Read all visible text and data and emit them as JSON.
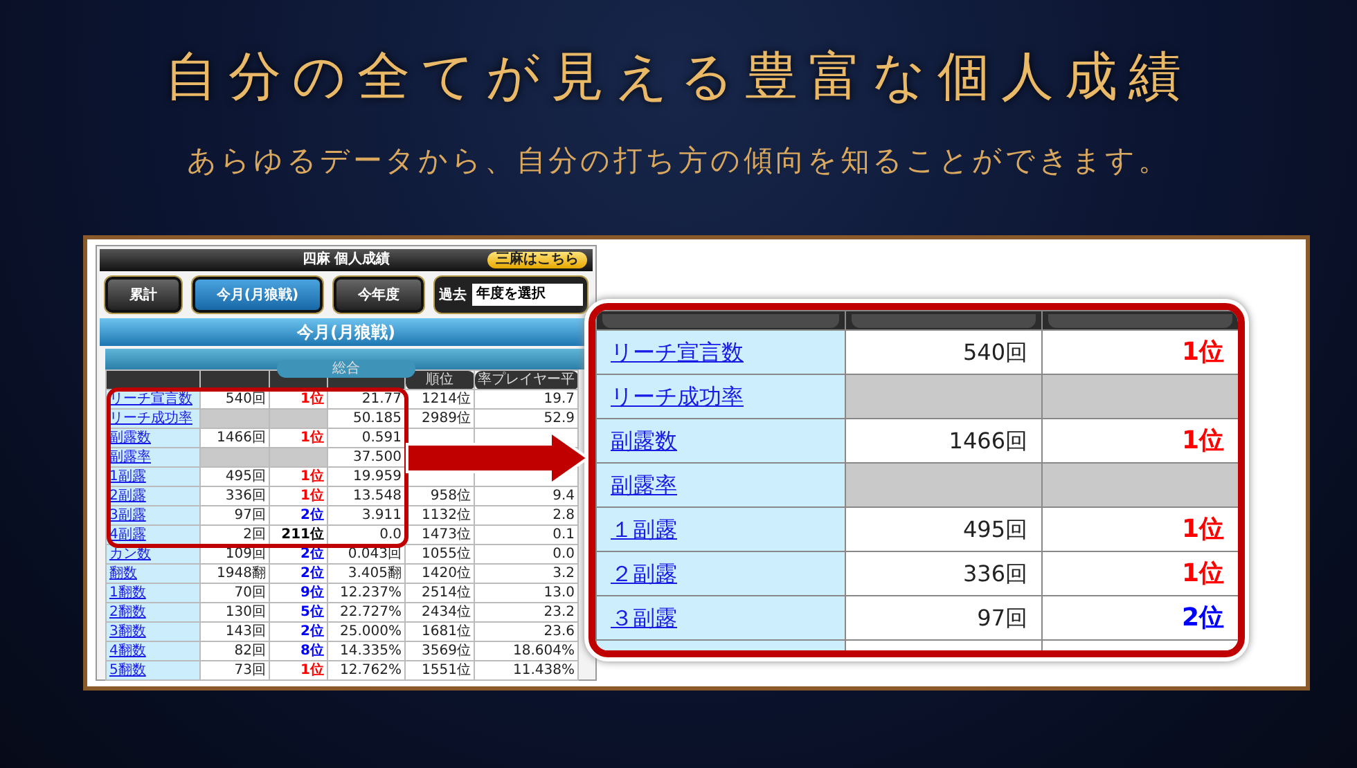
{
  "headline": "自分の全てが見える豊富な個人成績",
  "subheadline": "あらゆるデータから、自分の打ち方の傾向を知ることができます。",
  "app": {
    "title": "四麻 個人成績",
    "switch_button": "三麻はこちら",
    "period_tabs": [
      {
        "label": "累計",
        "selected": false
      },
      {
        "label": "今月(月狼戦)",
        "selected": true
      },
      {
        "label": "今年度",
        "selected": false
      }
    ],
    "past": {
      "label": "過去",
      "value": "年度を選択"
    },
    "section_title": "今月(月狼戦)",
    "subsection": "総合",
    "visible_headers": [
      "順位",
      "率プレイヤー平"
    ],
    "rows": [
      {
        "label": "リーチ宣言数",
        "kind": "count",
        "count": "540回",
        "rank": "1位",
        "color": "#ff0000",
        "rate": "21.77",
        "rate_rank": "1214位",
        "average": "19.7"
      },
      {
        "label": "リーチ成功率",
        "kind": "ratio",
        "rate": "50.185",
        "rate_rank": "2989位",
        "average": "52.9"
      },
      {
        "label": "副露数",
        "kind": "count",
        "count": "1466回",
        "rank": "1位",
        "color": "#ff0000",
        "rate": "0.591"
      },
      {
        "label": "副露率",
        "kind": "ratio",
        "rate": "37.500"
      },
      {
        "label": "1副露",
        "kind": "count",
        "count": "495回",
        "rank": "1位",
        "color": "#ff0000",
        "rate": "19.959"
      },
      {
        "label": "2副露",
        "kind": "count",
        "count": "336回",
        "rank": "1位",
        "color": "#ff0000",
        "rate": "13.548",
        "rate_rank": "958位",
        "average": "9.4"
      },
      {
        "label": "3副露",
        "kind": "count",
        "count": "97回",
        "rank": "2位",
        "color": "#0000ff",
        "rate": "3.911",
        "rate_rank": "1132位",
        "average": "2.8"
      },
      {
        "label": "4副露",
        "kind": "count",
        "count": "2回",
        "rank": "211位",
        "color": "#000000",
        "rate": "0.0",
        "rate_rank": "1473位",
        "average": "0.1"
      },
      {
        "label": "カン数",
        "kind": "count",
        "count": "109回",
        "rank": "2位",
        "color": "#0000ff",
        "rate": "0.043回",
        "rate_rank": "1055位",
        "average": "0.0"
      },
      {
        "label": "翻数",
        "kind": "count",
        "count": "1948翻",
        "rank": "2位",
        "color": "#0000ff",
        "rate": "3.405翻",
        "rate_rank": "1420位",
        "average": "3.2"
      },
      {
        "label": "1翻数",
        "kind": "count",
        "count": "70回",
        "rank": "9位",
        "color": "#0000ff",
        "rate": "12.237%",
        "rate_rank": "2514位",
        "average": "13.0"
      },
      {
        "label": "2翻数",
        "kind": "count",
        "count": "130回",
        "rank": "5位",
        "color": "#0000ff",
        "rate": "22.727%",
        "rate_rank": "2434位",
        "average": "23.2"
      },
      {
        "label": "3翻数",
        "kind": "count",
        "count": "143回",
        "rank": "2位",
        "color": "#0000ff",
        "rate": "25.000%",
        "rate_rank": "1681位",
        "average": "23.6"
      },
      {
        "label": "4翻数",
        "kind": "count",
        "count": "82回",
        "rank": "8位",
        "color": "#0000ff",
        "rate": "14.335%",
        "rate_rank": "3569位",
        "average": "18.604%"
      },
      {
        "label": "5翻数",
        "kind": "count",
        "count": "73回",
        "rank": "1位",
        "color": "#ff0000",
        "rate": "12.762%",
        "rate_rank": "1551位",
        "average": "11.438%"
      }
    ]
  },
  "zoom_table": {
    "rows": [
      {
        "label": "リーチ宣言数",
        "kind": "count",
        "count": "540回",
        "rank": "1位",
        "color": "#ff0000"
      },
      {
        "label": "リーチ成功率",
        "kind": "ratio"
      },
      {
        "label": "副露数",
        "kind": "count",
        "count": "1466回",
        "rank": "1位",
        "color": "#ff0000"
      },
      {
        "label": "副露率",
        "kind": "ratio"
      },
      {
        "label": "１副露",
        "kind": "count",
        "count": "495回",
        "rank": "1位",
        "color": "#ff0000"
      },
      {
        "label": "２副露",
        "kind": "count",
        "count": "336回",
        "rank": "1位",
        "color": "#ff0000"
      },
      {
        "label": "３副露",
        "kind": "count",
        "count": "97回",
        "rank": "2位",
        "color": "#0000ff"
      }
    ]
  }
}
